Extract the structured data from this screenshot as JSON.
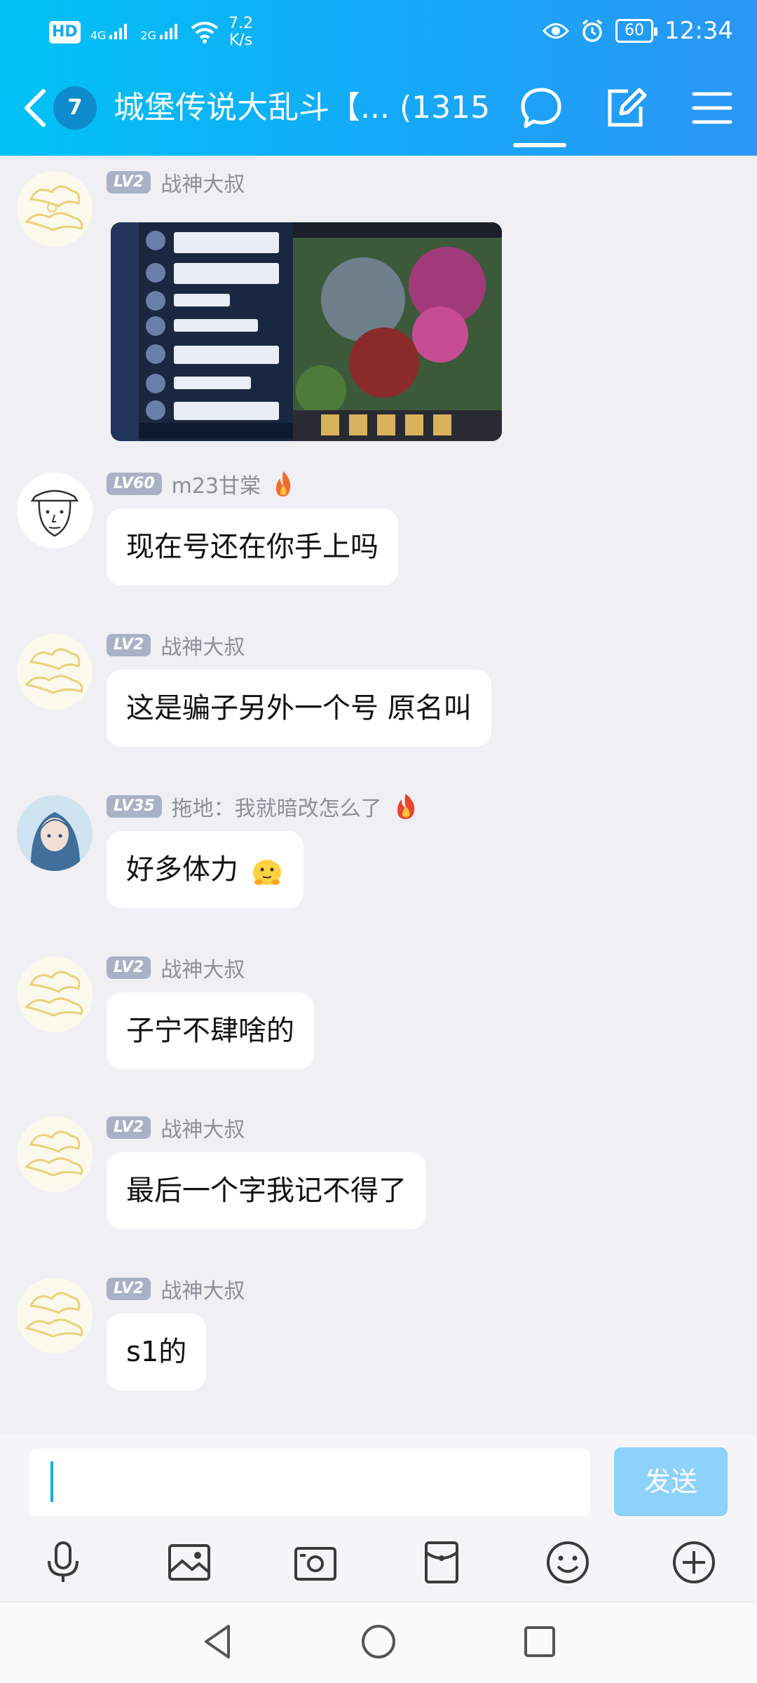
{
  "status_bar": {
    "hd": "HD",
    "hd_sub": "1",
    "net1": "4G",
    "net2": "2G",
    "speed_value": "7.2",
    "speed_unit": "K/s",
    "battery": "60",
    "time": "12:34"
  },
  "header": {
    "unread_count": "7",
    "title": "城堡传说大乱斗【... (1315)"
  },
  "messages": [
    {
      "level": "LV2",
      "name": "战神大叔",
      "type": "image"
    },
    {
      "level": "LV60",
      "name": "m23甘棠",
      "text": "现在号还在你手上吗"
    },
    {
      "level": "LV2",
      "name": "战神大叔",
      "text": "这是骗子另外一个号 原名叫"
    },
    {
      "level": "LV35",
      "name": "拖地：我就暗改怎么了",
      "text": "好多体力"
    },
    {
      "level": "LV2",
      "name": "战神大叔",
      "text": "子宁不肆啥的"
    },
    {
      "level": "LV2",
      "name": "战神大叔",
      "text": "最后一个字我记不得了"
    },
    {
      "level": "LV2",
      "name": "战神大叔",
      "text": "s1的"
    }
  ],
  "input": {
    "value": "",
    "send_label": "发送"
  },
  "toolbar_icons": [
    "microphone-icon",
    "image-icon",
    "camera-icon",
    "red-packet-icon",
    "emoji-icon",
    "add-icon"
  ],
  "colors": {
    "header_gradient_start": "#00c2f5",
    "header_gradient_end": "#2a96f6",
    "accent": "#14a9f5",
    "level_badge": "#a9b1c7",
    "send_disabled": "#8dd2fb"
  }
}
